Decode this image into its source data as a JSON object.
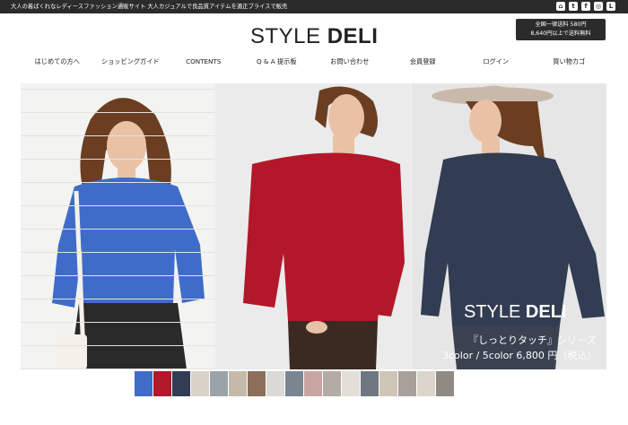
{
  "top_bar": {
    "tagline": "大人の着ばくれなレディースファッション通販サイト 大人カジュアルで良品質アイテムを適正プライスで販売",
    "social_icons": [
      "home-icon",
      "twitter-icon",
      "facebook-icon",
      "instagram-icon",
      "line-icon"
    ]
  },
  "logo": {
    "light": "STYLE ",
    "bold": "DELI"
  },
  "shipping": {
    "line1": "全国一律送料 580円",
    "line2": "8,640円以上で送料無料"
  },
  "nav": {
    "items": [
      "はじめての方へ",
      "ショッピングガイド",
      "CONTENTS",
      "Q & A 提示板",
      "お問い合わせ",
      "会員登録",
      "ログイン",
      "買い物カゴ"
    ]
  },
  "hero": {
    "logo_light": "STYLE ",
    "logo_bold": "DELI",
    "series": "『しっとりタッチ』シリーズ",
    "price": "3color / 5color  6,800 円（税込）",
    "colors": {
      "sweater_blue": "#3f6cc8",
      "sweater_red": "#b3182a",
      "sweater_navy": "#323c52",
      "skirt_black": "#2a2a2a",
      "skin": "#e9c2a6",
      "hair_brown": "#6b3e22",
      "hat_beige": "#c9b9aa"
    }
  },
  "thumbnails": {
    "colors": [
      "#3f6cc8",
      "#b3182a",
      "#323c52",
      "#d8d2c8",
      "#9aa4a8",
      "#c5b9aa",
      "#8c6f5a",
      "#d9d9d6",
      "#7a8590",
      "#c8a5a0",
      "#b4aca4",
      "#e3ded6",
      "#6f7780",
      "#cfc5b7",
      "#a8a09a",
      "#dcd5cc",
      "#8f8a84"
    ]
  }
}
